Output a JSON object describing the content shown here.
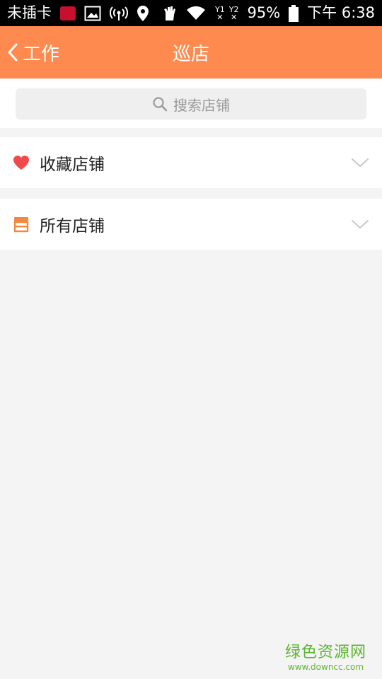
{
  "status_bar": {
    "carrier": "未插卡",
    "sim1_label": "Y1",
    "sim2_label": "Y2",
    "battery": "95%",
    "time": "下午 6:38"
  },
  "header": {
    "back_label": "工作",
    "title": "巡店"
  },
  "search": {
    "placeholder": "搜索店铺"
  },
  "sections": [
    {
      "label": "收藏店铺",
      "icon": "heart-icon",
      "icon_color": "#f04a4a"
    },
    {
      "label": "所有店铺",
      "icon": "store-icon",
      "icon_color": "#f5883e"
    }
  ],
  "watermark": {
    "title": "绿色资源网",
    "url": "www.downcc.com"
  },
  "colors": {
    "accent": "#ff8a50",
    "background": "#f4f4f4"
  }
}
